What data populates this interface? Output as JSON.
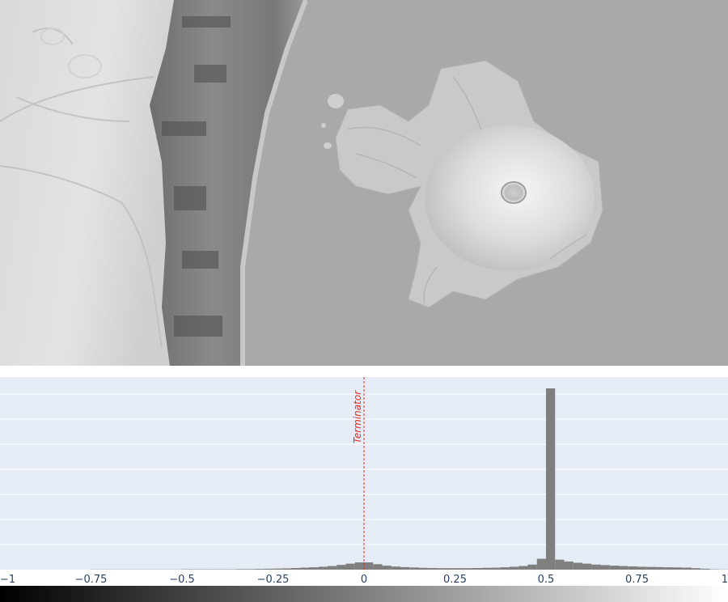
{
  "image_panel": {
    "description_role": "hillshade-relief-map",
    "colors": {
      "background": "#a9a9a9",
      "terrain_light": "#e4e4e4",
      "terrain_mid": "#c8c8c8",
      "cliff_dark": "#5f5f5f",
      "water": "#a8a8a8"
    }
  },
  "chart_data": {
    "type": "bar",
    "title": "",
    "xlabel": "",
    "ylabel": "",
    "xlim": [
      -1,
      1
    ],
    "ylim": [
      0,
      1
    ],
    "xticks": [
      -1,
      -0.75,
      -0.5,
      -0.25,
      0,
      0.25,
      0.5,
      0.75,
      1
    ],
    "xtick_labels": [
      "−1",
      "−0.75",
      "−0.5",
      "−0.25",
      "0",
      "0.25",
      "0.5",
      "0.75",
      "1"
    ],
    "grid": true,
    "bin_width": 0.025,
    "x": [
      -1.0,
      -0.975,
      -0.95,
      -0.925,
      -0.9,
      -0.875,
      -0.85,
      -0.825,
      -0.8,
      -0.775,
      -0.75,
      -0.725,
      -0.7,
      -0.675,
      -0.65,
      -0.625,
      -0.6,
      -0.575,
      -0.55,
      -0.525,
      -0.5,
      -0.475,
      -0.45,
      -0.425,
      -0.4,
      -0.375,
      -0.35,
      -0.325,
      -0.3,
      -0.275,
      -0.25,
      -0.225,
      -0.2,
      -0.175,
      -0.15,
      -0.125,
      -0.1,
      -0.075,
      -0.05,
      -0.025,
      0.0,
      0.025,
      0.05,
      0.075,
      0.1,
      0.125,
      0.15,
      0.175,
      0.2,
      0.225,
      0.25,
      0.275,
      0.3,
      0.325,
      0.35,
      0.375,
      0.4,
      0.425,
      0.45,
      0.475,
      0.5,
      0.525,
      0.55,
      0.575,
      0.6,
      0.625,
      0.65,
      0.675,
      0.7,
      0.725,
      0.75,
      0.775,
      0.8,
      0.825,
      0.85,
      0.875,
      0.9,
      0.925,
      0.95,
      0.975
    ],
    "values": [
      0,
      0,
      0,
      0,
      0,
      0,
      0,
      0,
      0,
      0,
      0.001,
      0.001,
      0.001,
      0.001,
      0.001,
      0.001,
      0.001,
      0.001,
      0.001,
      0.001,
      0.002,
      0.002,
      0.002,
      0.002,
      0.002,
      0.002,
      0.003,
      0.003,
      0.004,
      0.005,
      0.006,
      0.007,
      0.009,
      0.011,
      0.013,
      0.016,
      0.02,
      0.026,
      0.033,
      0.04,
      0.04,
      0.03,
      0.022,
      0.017,
      0.014,
      0.012,
      0.01,
      0.009,
      0.008,
      0.008,
      0.008,
      0.008,
      0.009,
      0.01,
      0.011,
      0.013,
      0.016,
      0.02,
      0.028,
      0.06,
      1.0,
      0.055,
      0.045,
      0.038,
      0.033,
      0.028,
      0.025,
      0.022,
      0.02,
      0.018,
      0.016,
      0.015,
      0.014,
      0.013,
      0.012,
      0.011,
      0.008,
      0.005,
      0.002,
      0.001
    ],
    "bar_color": "#7f7f7f",
    "plot_bgcolor": "#e5ecf6",
    "annotations": [
      {
        "x": 0,
        "text": "Terminator",
        "color": "#e02b20",
        "style": "dashed-vertical-line"
      }
    ],
    "colorbar": {
      "from": "#000000",
      "to": "#ffffff",
      "orientation": "horizontal"
    }
  }
}
